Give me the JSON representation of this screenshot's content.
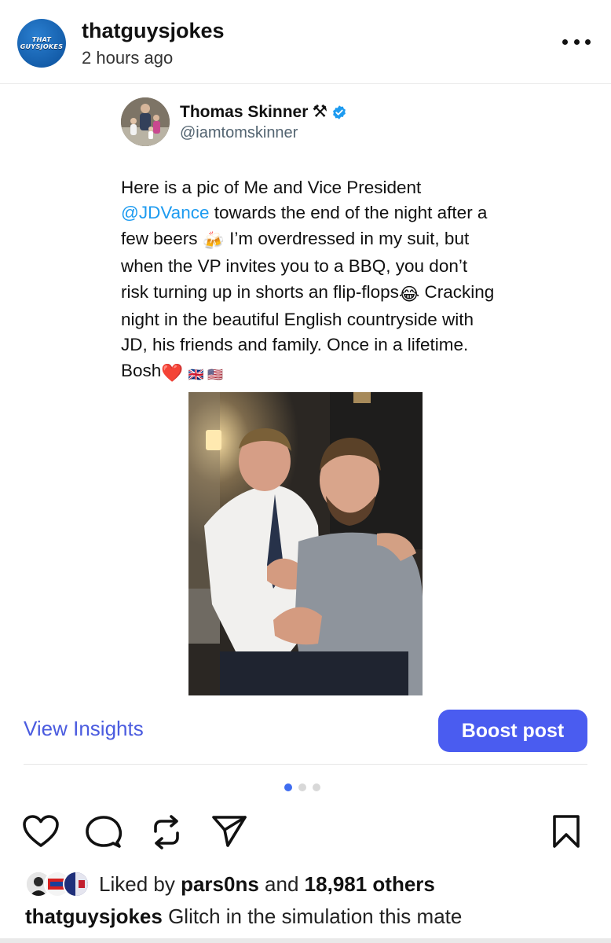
{
  "post": {
    "username": "thatguysjokes",
    "timestamp": "2 hours ago",
    "avatar_text_line1": "THAT",
    "avatar_text_line2": "GUYSJOKES"
  },
  "tweet": {
    "display_name": "Thomas Skinner",
    "name_emoji": "⚒",
    "handle": "@iamtomskinner",
    "text_part1": "Here is a pic of Me and Vice President ",
    "mention": "@JDVance",
    "text_part2": " towards the end of the night after a few beers",
    "emoji_beers": "🍻",
    "text_part3": " I’m overdressed in my suit, but when the VP invites you to a BBQ, you don’t risk turning up in shorts an flip-flops",
    "emoji_laugh": "😂",
    "text_part4": " Cracking night in the beautiful English countryside with JD, his friends and family. Once in a lifetime. Bosh",
    "emoji_heart": "❤️",
    "emoji_flags": "🇬🇧 🇺🇸"
  },
  "actions": {
    "view_insights": "View Insights",
    "boost_post": "Boost post"
  },
  "carousel": {
    "total": 3,
    "active": 1
  },
  "likes": {
    "liked_by": "Liked by",
    "first_liker": "pars0ns",
    "and": "and",
    "others": "18,981 others"
  },
  "caption": {
    "username": "thatguysjokes",
    "text": "Glitch in the simulation this mate"
  },
  "colors": {
    "accent": "#4a5cf0",
    "mention": "#1d9bf0",
    "verified": "#1d9bf0"
  }
}
